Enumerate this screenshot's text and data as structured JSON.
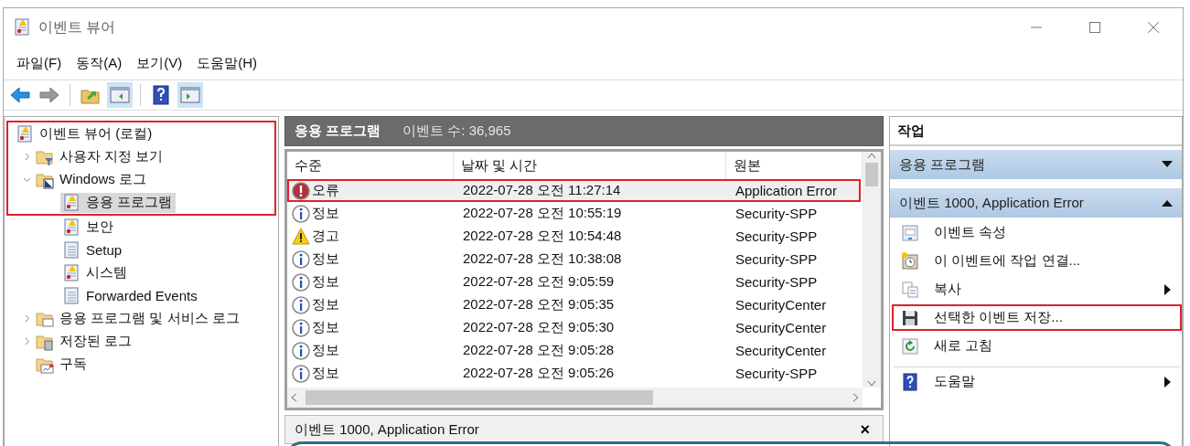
{
  "window": {
    "title": "이벤트 뷰어"
  },
  "menu": [
    "파일(F)",
    "동작(A)",
    "보기(V)",
    "도움말(H)"
  ],
  "tree": [
    {
      "label": "이벤트 뷰어 (로컬)",
      "kind": "root",
      "selected": false,
      "highlighted": true,
      "children": [
        {
          "label": "사용자 지정 보기",
          "kind": "filter-folder",
          "expanded": false,
          "selected": false,
          "highlighted": true
        },
        {
          "label": "Windows 로그",
          "kind": "logs-folder",
          "expanded": true,
          "selected": false,
          "highlighted": true,
          "children": [
            {
              "label": "응용 프로그램",
              "kind": "log-alert",
              "selected": true,
              "highlighted": true
            },
            {
              "label": "보안",
              "kind": "log-alert",
              "selected": false,
              "highlighted": false
            },
            {
              "label": "Setup",
              "kind": "log",
              "selected": false,
              "highlighted": false
            },
            {
              "label": "시스템",
              "kind": "log-alert",
              "selected": false,
              "highlighted": false
            },
            {
              "label": "Forwarded Events",
              "kind": "log",
              "selected": false,
              "highlighted": false
            }
          ]
        },
        {
          "label": "응용 프로그램 및 서비스 로그",
          "kind": "folder",
          "expanded": false,
          "selected": false,
          "highlighted": false
        },
        {
          "label": "저장된 로그",
          "kind": "saved-folder",
          "expanded": false,
          "selected": false,
          "highlighted": false
        },
        {
          "label": "구독",
          "kind": "subscription",
          "selected": false,
          "highlighted": false
        }
      ]
    }
  ],
  "events": {
    "title": "응용 프로그램",
    "count": "이벤트 수: 36,965",
    "columns": [
      "수준",
      "날짜 및 시간",
      "원본"
    ],
    "rows": [
      {
        "kind": "error",
        "level": "오류",
        "date": "2022-07-28 오전 11:27:14",
        "source": "Application Error",
        "selected": true,
        "highlighted": true
      },
      {
        "kind": "info",
        "level": "정보",
        "date": "2022-07-28 오전 10:55:19",
        "source": "Security-SPP",
        "selected": false,
        "highlighted": false
      },
      {
        "kind": "warning",
        "level": "경고",
        "date": "2022-07-28 오전 10:54:48",
        "source": "Security-SPP",
        "selected": false,
        "highlighted": false
      },
      {
        "kind": "info",
        "level": "정보",
        "date": "2022-07-28 오전 10:38:08",
        "source": "Security-SPP",
        "selected": false,
        "highlighted": false
      },
      {
        "kind": "info",
        "level": "정보",
        "date": "2022-07-28 오전 9:05:59",
        "source": "Security-SPP",
        "selected": false,
        "highlighted": false
      },
      {
        "kind": "info",
        "level": "정보",
        "date": "2022-07-28 오전 9:05:35",
        "source": "SecurityCenter",
        "selected": false,
        "highlighted": false
      },
      {
        "kind": "info",
        "level": "정보",
        "date": "2022-07-28 오전 9:05:30",
        "source": "SecurityCenter",
        "selected": false,
        "highlighted": false
      },
      {
        "kind": "info",
        "level": "정보",
        "date": "2022-07-28 오전 9:05:28",
        "source": "SecurityCenter",
        "selected": false,
        "highlighted": false
      },
      {
        "kind": "info",
        "level": "정보",
        "date": "2022-07-28 오전 9:05:26",
        "source": "Security-SPP",
        "selected": false,
        "highlighted": false
      }
    ]
  },
  "detail": {
    "title": "이벤트 1000, Application Error",
    "close": "×"
  },
  "actions": {
    "title": "작업",
    "sections": [
      {
        "title": "응용 프로그램",
        "expanded": false
      },
      {
        "title": "이벤트 1000, Application Error",
        "expanded": true,
        "items": [
          {
            "kind": "properties",
            "label": "이벤트 속성",
            "submenu": false,
            "highlighted": false,
            "divider_before": false
          },
          {
            "kind": "task",
            "label": "이 이벤트에 작업 연결...",
            "submenu": false,
            "highlighted": false,
            "divider_before": false
          },
          {
            "kind": "copy",
            "label": "복사",
            "submenu": true,
            "highlighted": false,
            "divider_before": false
          },
          {
            "kind": "save",
            "label": "선택한 이벤트 저장...",
            "submenu": false,
            "highlighted": true,
            "divider_before": false
          },
          {
            "kind": "refresh",
            "label": "새로 고침",
            "submenu": false,
            "highlighted": false,
            "divider_before": false
          },
          {
            "kind": "help",
            "label": "도움말",
            "submenu": true,
            "highlighted": false,
            "divider_before": true
          }
        ]
      }
    ]
  }
}
